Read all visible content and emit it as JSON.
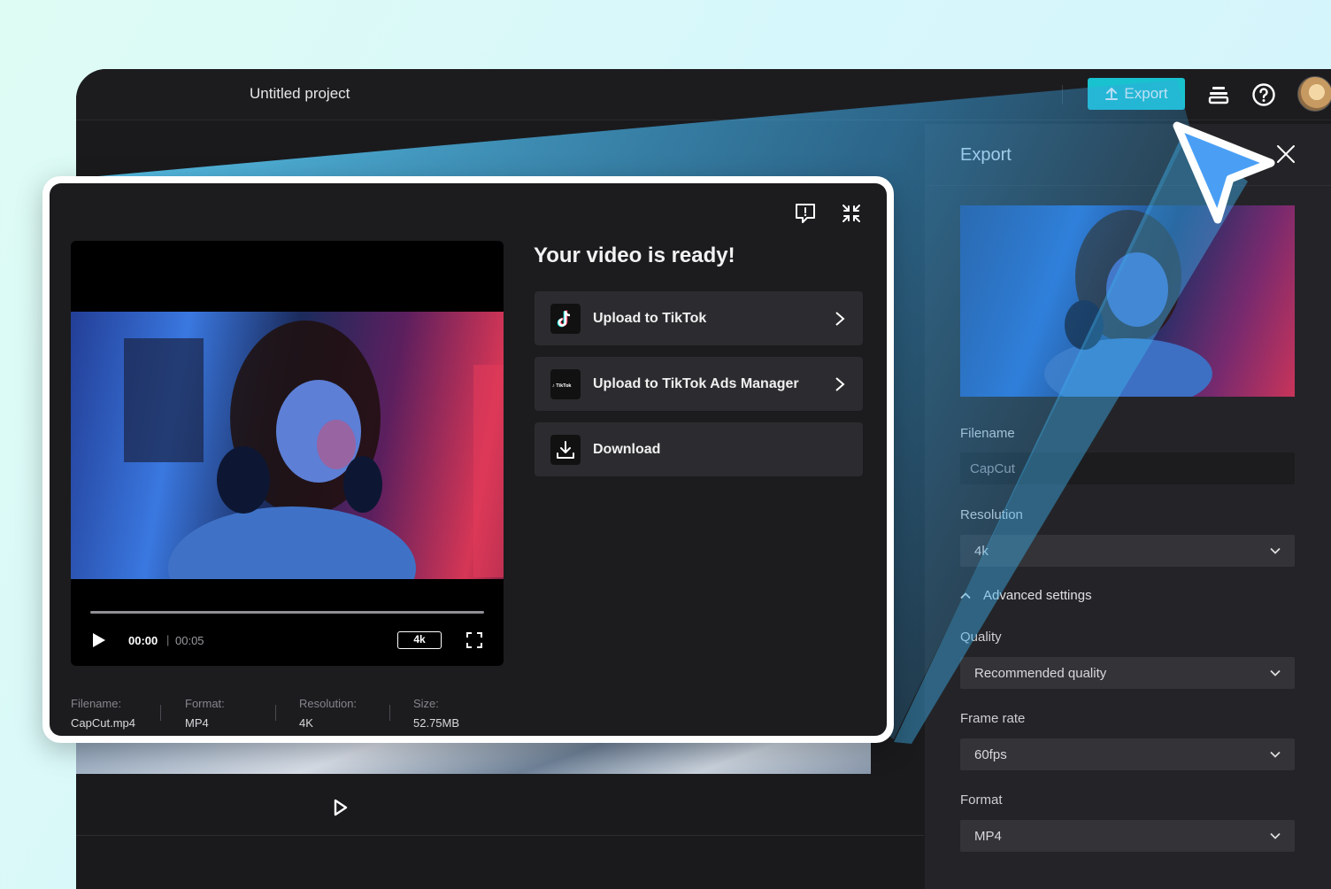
{
  "topbar": {
    "project_title": "Untitled project",
    "export_label": "Export"
  },
  "export_panel": {
    "title": "Export",
    "filename_label": "Filename",
    "filename_value": "CapCut",
    "resolution_label": "Resolution",
    "resolution_value": "4k",
    "advanced_label": "Advanced settings",
    "quality_label": "Quality",
    "quality_value": "Recommended quality",
    "framerate_label": "Frame rate",
    "framerate_value": "60fps",
    "format_label": "Format",
    "format_value": "MP4"
  },
  "ready_card": {
    "title": "Your video is ready!",
    "actions": [
      {
        "label": "Upload to TikTok",
        "icon": "tiktok-icon"
      },
      {
        "label": "Upload to TikTok Ads Manager",
        "icon": "tiktok-business-icon"
      },
      {
        "label": "Download",
        "icon": "download-icon"
      }
    ],
    "player": {
      "current_time": "00:00",
      "separator": "|",
      "duration": "00:05",
      "resolution_badge": "4k",
      "progress": 0
    },
    "meta": [
      {
        "key": "Filename:",
        "value": "CapCut.mp4"
      },
      {
        "key": "Format:",
        "value": "MP4"
      },
      {
        "key": "Resolution:",
        "value": "4K"
      },
      {
        "key": "Size:",
        "value": "52.75MB"
      }
    ],
    "tiktok_business_mark": "TikTok For Business"
  },
  "colors": {
    "accent": "#19c2cf",
    "cursor": "#4a9ff5",
    "wedge": "#3fb2ee"
  }
}
